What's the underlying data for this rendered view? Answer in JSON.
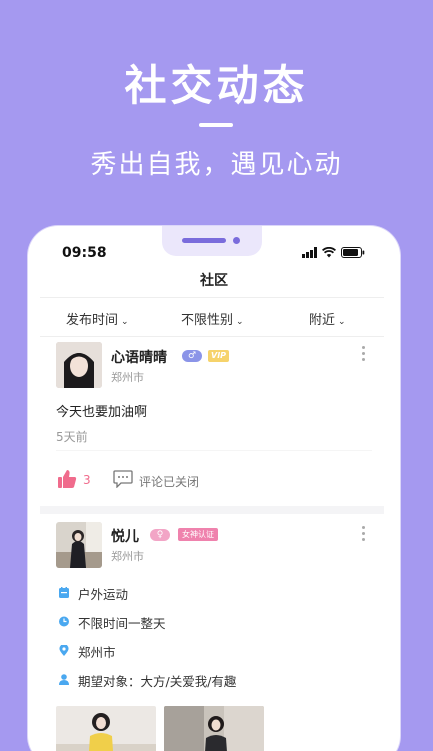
{
  "hero": {
    "title": "社交动态",
    "subtitle": "秀出自我，遇见心动"
  },
  "status_bar": {
    "time": "09:58"
  },
  "page": {
    "title": "社区"
  },
  "filters": [
    {
      "label": "发布时间",
      "icon": "chevron-down-icon"
    },
    {
      "label": "不限性别",
      "icon": "chevron-down-icon"
    },
    {
      "label": "附近",
      "icon": "chevron-down-icon"
    }
  ],
  "posts": [
    {
      "name": "心语晴晴",
      "gender_symbol": "♂",
      "badge": "VIP",
      "city": "郑州市",
      "text": "今天也要加油啊",
      "time": "5天前",
      "likes": "3",
      "comment_status": "评论已关闭"
    },
    {
      "name": "悦儿",
      "gender_symbol": "♀",
      "badge": "女神认证",
      "city": "郑州市",
      "details": [
        "户外运动",
        "不限时间一整天",
        "郑州市",
        "期望对象：大方/关爱我/有趣"
      ]
    }
  ],
  "colors": {
    "background": "#a599f0",
    "accent": "#7a6cdc",
    "like": "#f06b8c",
    "vip": "#f6d36b",
    "goddess": "#ef82ad",
    "male": "#8b94e8",
    "female": "#f2a5c6",
    "detail_icon": "#4aa8f0"
  }
}
